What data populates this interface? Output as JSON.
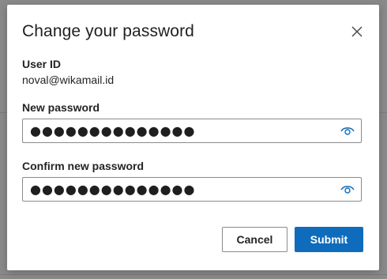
{
  "dialog": {
    "title": "Change your password",
    "close_icon": "close-icon"
  },
  "user": {
    "label": "User ID",
    "value": "noval@wikamail.id"
  },
  "new_password": {
    "label": "New password",
    "masked_value": "●●●●●●●●●●●●●●",
    "toggle_icon": "eye-icon"
  },
  "confirm_password": {
    "label": "Confirm new password",
    "masked_value": "●●●●●●●●●●●●●●",
    "toggle_icon": "eye-icon"
  },
  "buttons": {
    "cancel": "Cancel",
    "submit": "Submit"
  },
  "colors": {
    "primary": "#0f6cbd",
    "eye_icon": "#0f6cbd",
    "backdrop": "#8a8a8a"
  }
}
